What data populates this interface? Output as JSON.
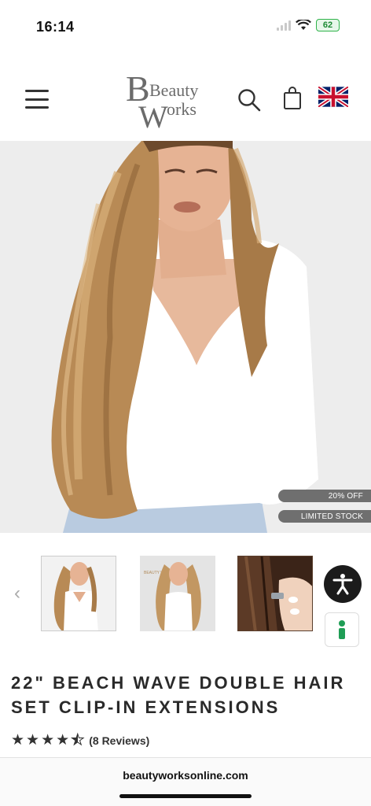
{
  "status_bar": {
    "time": "16:14",
    "battery": "62"
  },
  "header": {
    "logo_line1": "Beauty",
    "logo_line2": "Works",
    "menu_icon": "hamburger-menu-icon",
    "search_icon": "search-icon",
    "bag_icon": "shopping-bag-icon",
    "flag_icon": "uk-flag-icon"
  },
  "hero": {
    "badges": [
      "20% OFF",
      "LIMITED STOCK"
    ]
  },
  "gallery": {
    "prev_label": "‹",
    "thumb_text": "BEAUTY WORKS"
  },
  "product": {
    "title": "22\" BEACH WAVE DOUBLE HAIR SET CLIP-IN EXTENSIONS",
    "rating": 4.5,
    "reviews": "(8 Reviews)"
  },
  "browser": {
    "url": "beautyworksonline.com"
  },
  "colors": {
    "badge_bg": "#6f6f6f",
    "accessibility_bg": "#1b1b1b",
    "help_green": "#1f9d55"
  }
}
